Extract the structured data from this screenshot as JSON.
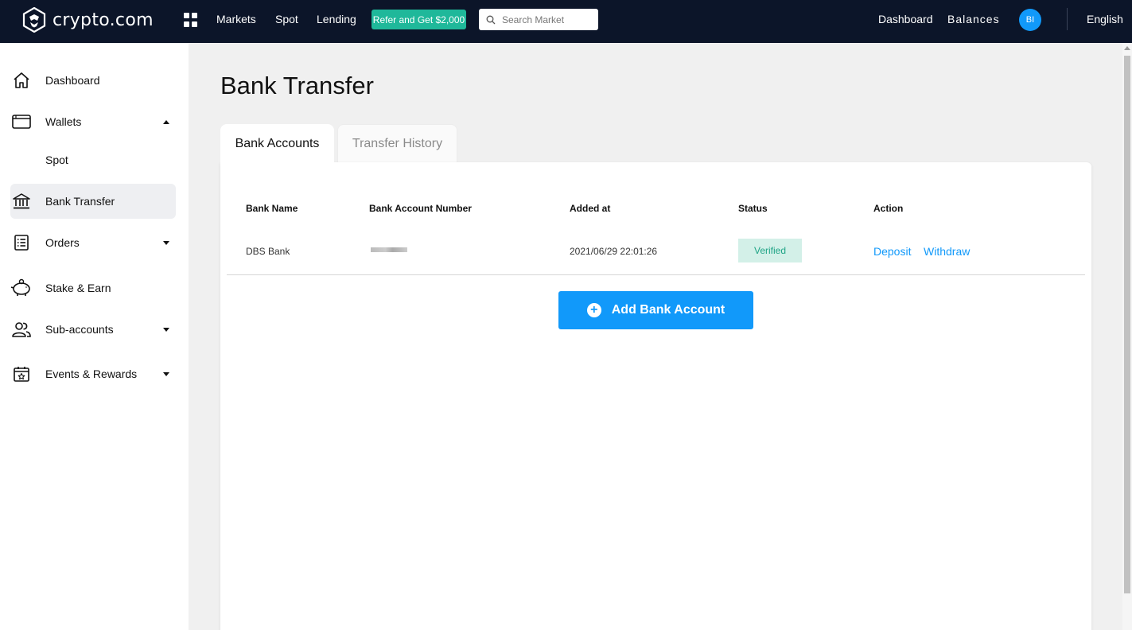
{
  "header": {
    "brand": "crypto.com",
    "nav": [
      "Markets",
      "Spot",
      "Lending"
    ],
    "refer_label": "Refer and Get $2,000",
    "search_placeholder": "Search Market",
    "dashboard_label": "Dashboard",
    "balances_label": "Balances",
    "avatar_initials": "BI",
    "language": "English"
  },
  "sidebar": {
    "items": [
      {
        "label": "Dashboard",
        "icon": "home-icon"
      },
      {
        "label": "Wallets",
        "icon": "wallet-icon",
        "expanded": true
      },
      {
        "label": "Spot"
      },
      {
        "label": "Bank Transfer",
        "icon": "bank-icon",
        "active": true
      },
      {
        "label": "Orders",
        "icon": "orders-icon"
      },
      {
        "label": "Stake & Earn",
        "icon": "piggy-bank-icon"
      },
      {
        "label": "Sub-accounts",
        "icon": "users-icon"
      },
      {
        "label": "Events & Rewards",
        "icon": "calendar-star-icon"
      }
    ]
  },
  "main": {
    "title": "Bank Transfer",
    "tabs": [
      {
        "label": "Bank Accounts",
        "active": true
      },
      {
        "label": "Transfer History",
        "active": false
      }
    ],
    "table": {
      "columns": [
        "Bank Name",
        "Bank Account Number",
        "Added at",
        "Status",
        "Action"
      ],
      "rows": [
        {
          "bank_name": "DBS Bank",
          "added_at": "2021/06/29 22:01:26",
          "status": "Verified",
          "actions": [
            "Deposit",
            "Withdraw"
          ]
        }
      ]
    },
    "add_button_label": "Add Bank Account"
  },
  "colors": {
    "topbar": "#0c1529",
    "accent": "#1199fa",
    "refer_green": "#1fb89a",
    "verified_bg": "#d3f0e8",
    "verified_text": "#1fa486"
  }
}
